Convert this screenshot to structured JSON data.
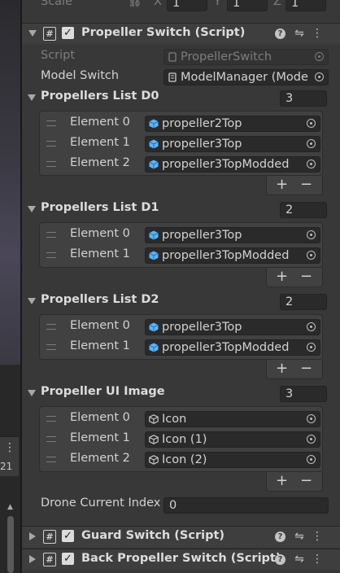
{
  "transform_row": {
    "label": "Scale",
    "axis_x": "X",
    "value_x": "1",
    "axis_y": "Y",
    "value_y": "1",
    "axis_z": "Z",
    "value_z": "1"
  },
  "components": [
    {
      "title": "Propeller Switch (Script)",
      "enabled": true,
      "expanded": true
    },
    {
      "title": "Guard Switch (Script)",
      "enabled": true,
      "expanded": false
    },
    {
      "title": "Back Propeller Switch (Script)",
      "enabled": true,
      "expanded": false
    }
  ],
  "script_field": {
    "label": "Script",
    "value": "PropellerSwitch"
  },
  "model_switch": {
    "label": "Model Switch",
    "value": "ModelManager (Mode"
  },
  "lists": [
    {
      "label": "Propellers List D0",
      "count": "3",
      "elements": [
        {
          "label": "Element 0",
          "value": "propeller2Top"
        },
        {
          "label": "Element 1",
          "value": "propeller3Top"
        },
        {
          "label": "Element 2",
          "value": "propeller3TopModded"
        }
      ]
    },
    {
      "label": "Propellers List D1",
      "count": "2",
      "elements": [
        {
          "label": "Element 0",
          "value": "propeller3Top"
        },
        {
          "label": "Element 1",
          "value": "propeller3TopModded"
        }
      ]
    },
    {
      "label": "Propellers List D2",
      "count": "2",
      "elements": [
        {
          "label": "Element 0",
          "value": "propeller3Top"
        },
        {
          "label": "Element 1",
          "value": "propeller3TopModded"
        }
      ]
    },
    {
      "label": "Propeller UI Image",
      "count": "3",
      "elements": [
        {
          "label": "Element 0",
          "value": "Icon"
        },
        {
          "label": "Element 1",
          "value": "Icon (1)"
        },
        {
          "label": "Element 2",
          "value": "Icon (2)"
        }
      ]
    }
  ],
  "drone_index": {
    "label": "Drone Current Index",
    "value": "0"
  },
  "list_buttons": {
    "add": "+",
    "remove": "−"
  },
  "left_strip": {
    "menu_glyph": "⋮",
    "number": "21"
  },
  "colors": {
    "prefab_cube": "#5ab4ff",
    "icon_cube": "#c8c8c8",
    "panel_bg": "#383838"
  }
}
